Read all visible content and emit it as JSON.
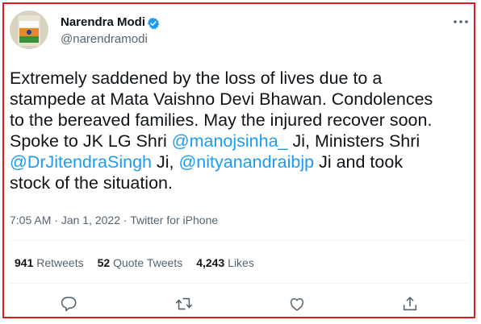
{
  "author": {
    "name": "Narendra Modi",
    "handle": "@narendramodi"
  },
  "tweet": {
    "line1": "Extremely saddened by the loss of lives due to a",
    "line2": "stampede at Mata Vaishno Devi Bhawan. Condolences",
    "line3": "to the bereaved families. May the injured recover soon.",
    "line4_a": "Spoke to JK LG Shri ",
    "mention1": "@manojsinha_",
    "line4_b": " Ji, Ministers Shri",
    "mention2": "@DrJitendraSingh",
    "line5_a": " Ji, ",
    "mention3": "@nityanandraibjp",
    "line5_b": " Ji and took",
    "line6": "stock of the situation."
  },
  "meta": {
    "time": "7:05 AM",
    "date": "Jan 1, 2022",
    "source": "Twitter for iPhone",
    "dot": " · "
  },
  "stats": {
    "retweets_count": "941",
    "retweets_label": "Retweets",
    "quotes_count": "52",
    "quotes_label": "Quote Tweets",
    "likes_count": "4,243",
    "likes_label": "Likes"
  },
  "icons": {
    "avatar": "profile-photo-india-badge",
    "verified": "verified-badge-icon",
    "more": "more-options-icon",
    "reply": "reply-icon",
    "retweet": "retweet-icon",
    "like": "like-icon",
    "share": "share-icon"
  },
  "colors": {
    "accent": "#1d9bf0",
    "frame": "#e0191f",
    "muted": "#536471",
    "text": "#0f1419"
  }
}
